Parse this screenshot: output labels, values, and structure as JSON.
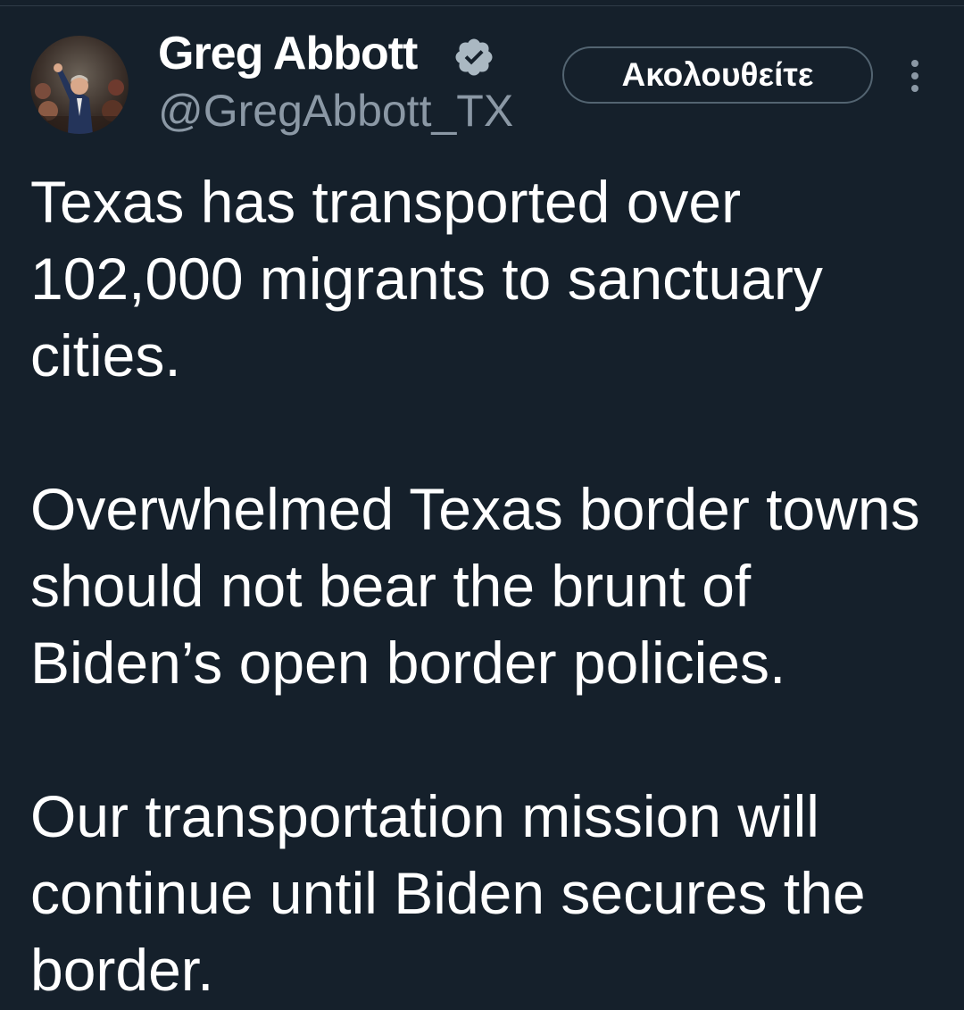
{
  "tweet": {
    "author": {
      "display_name": "Greg Abbott",
      "handle": "@GregAbbott_TX",
      "verified": true
    },
    "follow_button_label": "Ακολουθείτε",
    "paragraphs": [
      "Texas has transported over 102,000 migrants to sanctuary cities.",
      "Overwhelmed Texas border towns should not bear the brunt of Biden’s open border policies.",
      "Our transportation mission will continue until Biden secures the border."
    ]
  },
  "icons": {
    "verified": "verified-badge-icon",
    "more": "more-options-icon",
    "avatar": "profile-photo"
  },
  "colors": {
    "background": "#15202b",
    "text_primary": "#ffffff",
    "text_secondary": "#8b98a5",
    "button_border": "#536471",
    "verified_badge": "#aab8c2"
  }
}
